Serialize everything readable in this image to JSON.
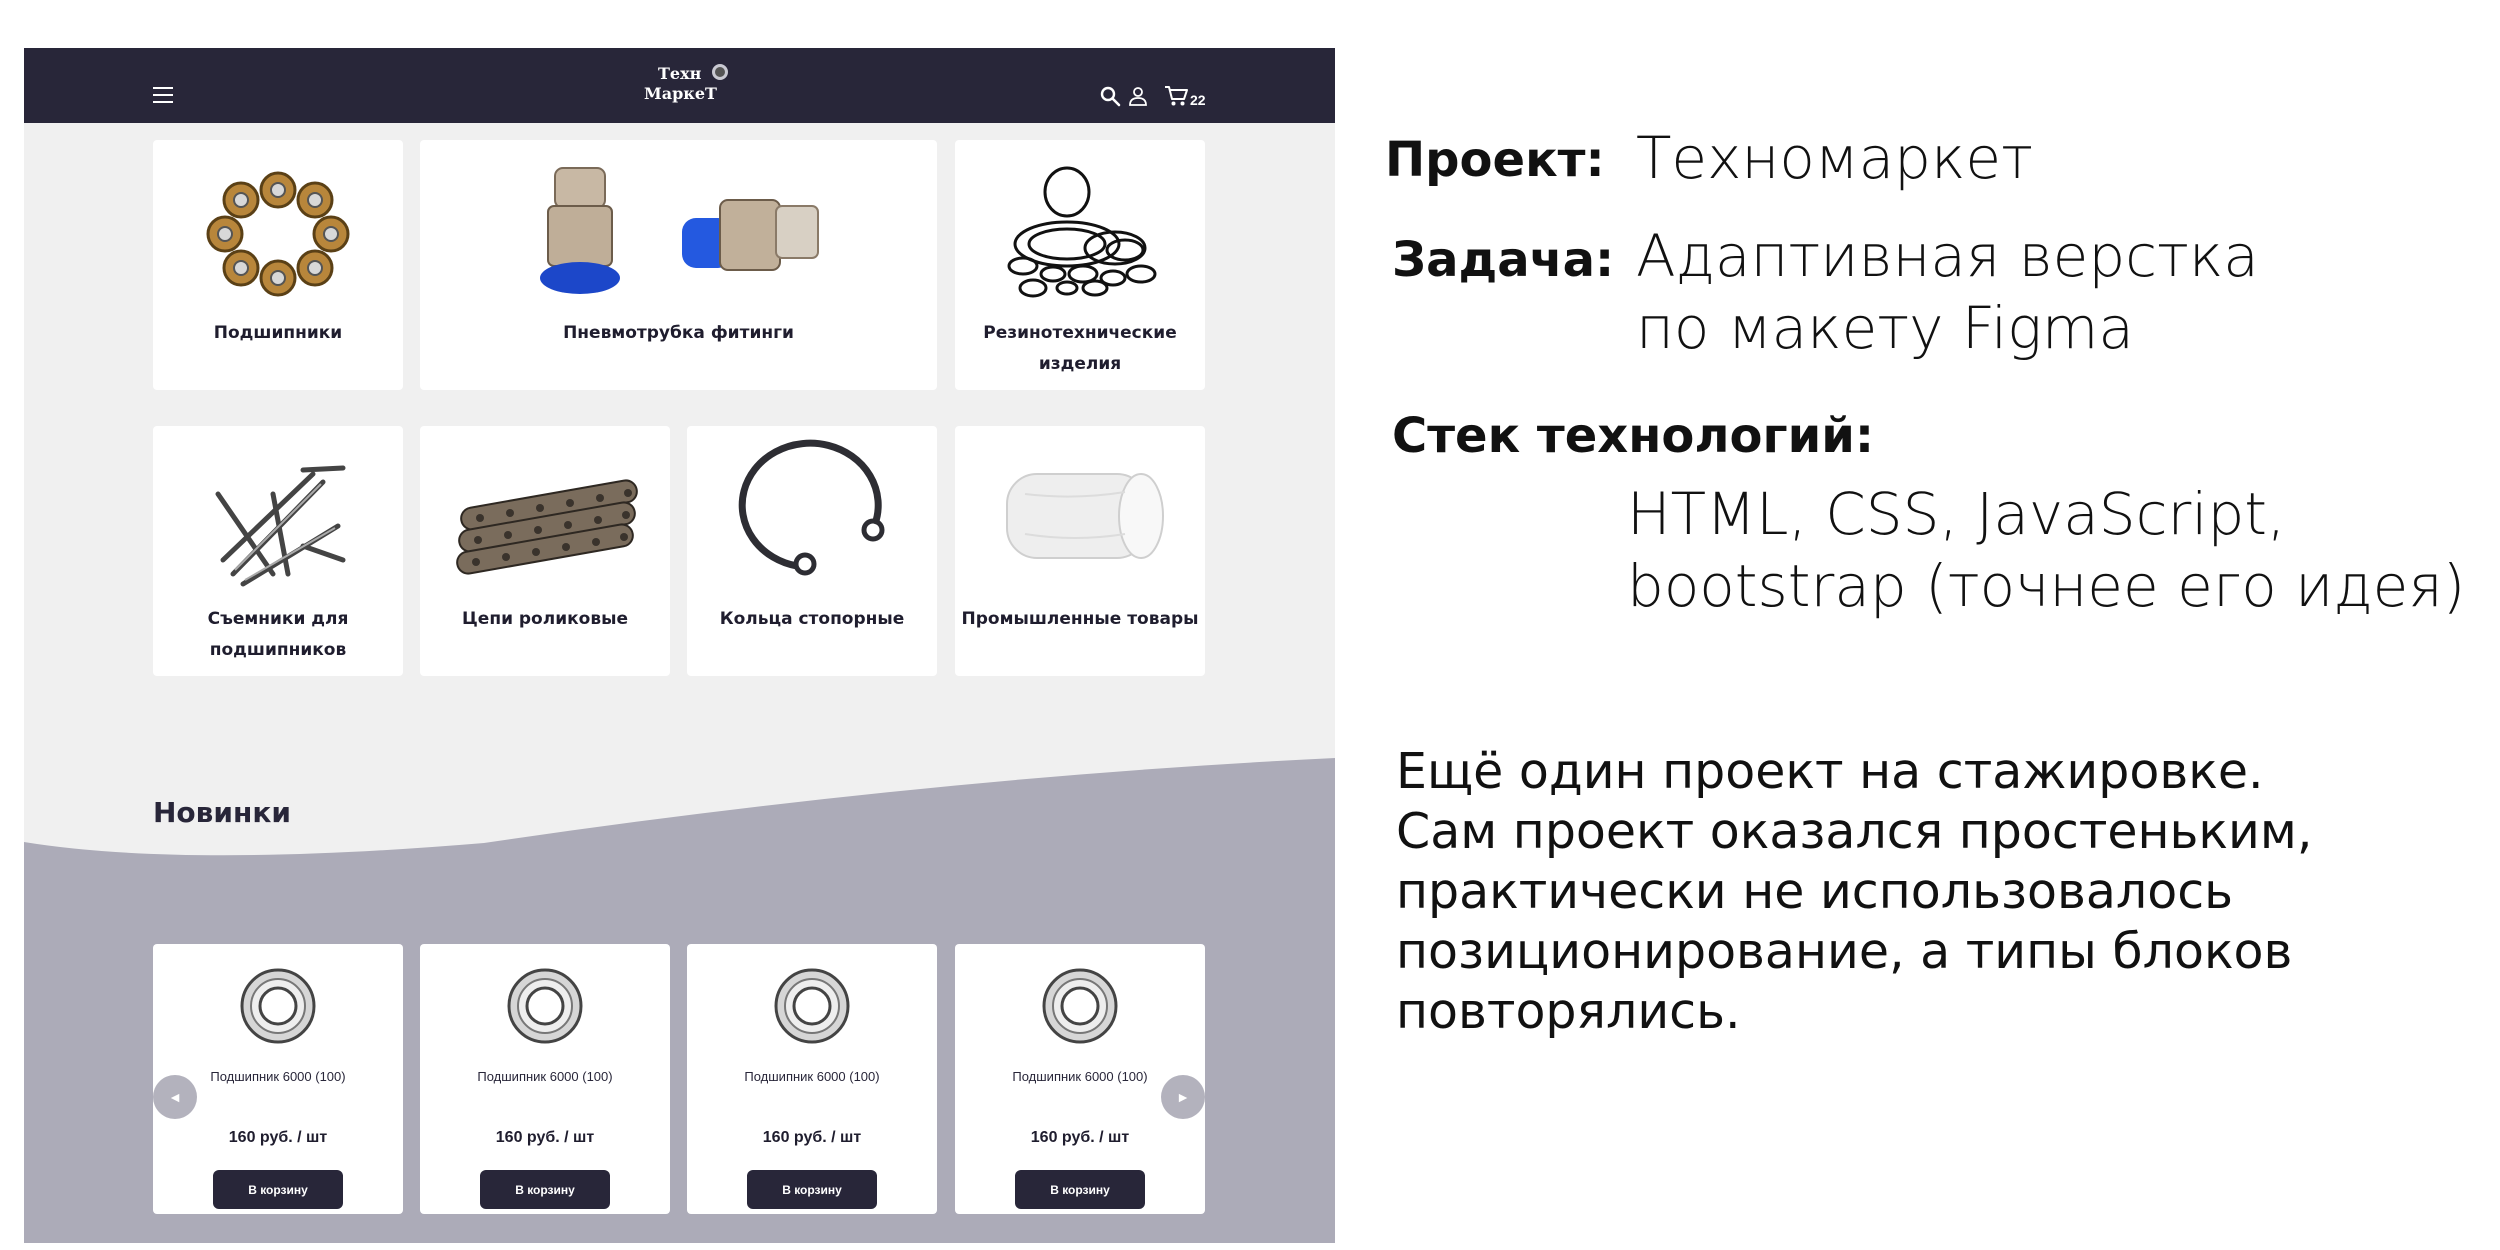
{
  "header": {
    "logo_line1": "Техн",
    "logo_line2": "МаркеТ",
    "cart_count": "22",
    "icons": [
      "menu-icon",
      "search-icon",
      "user-icon",
      "cart-icon"
    ]
  },
  "categories": [
    {
      "label": "Подшипники",
      "icon": "bearings-image"
    },
    {
      "label": "Пневмотрубка фитинги",
      "icon": "fittings-image"
    },
    {
      "label_line1": "Резинотехнические",
      "label_line2": "изделия",
      "icon": "o-rings-image"
    },
    {
      "label_line1": "Съемники для",
      "label_line2": "подшипников",
      "icon": "pullers-image"
    },
    {
      "label": "Цепи роликовые",
      "icon": "roller-chain-image"
    },
    {
      "label": "Кольца стопорные",
      "icon": "retaining-ring-image"
    },
    {
      "label": "Промышленные товары",
      "icon": "fabric-roll-image"
    }
  ],
  "new_section": {
    "title": "Новинки",
    "products": [
      {
        "name": "Подшипник 6000 (100)",
        "price": "160 руб. / шт",
        "button": "В корзину"
      },
      {
        "name": "Подшипник 6000 (100)",
        "price": "160 руб. / шт",
        "button": "В корзину"
      },
      {
        "name": "Подшипник 6000 (100)",
        "price": "160 руб. / шт",
        "button": "В корзину"
      },
      {
        "name": "Подшипник 6000 (100)",
        "price": "160 руб. / шт",
        "button": "В корзину"
      }
    ],
    "prev_arrow": "◄",
    "next_arrow": "►"
  },
  "description": {
    "project_label": "Проект:",
    "project_value": "Техномаркет",
    "task_label": "Задача:",
    "task_line1": "Адаптивная верстка",
    "task_line2": "по макету Figma",
    "stack_label": "Стек технологий:",
    "stack_line1": "HTML, CSS,  JavaScript,",
    "stack_line2": "bootstrap (точнее его идея)",
    "para": [
      "Ещё один проект на стажировке.",
      "Сам проект оказался простеньким,",
      "практически не использовалось",
      "позиционирование, а типы блоков",
      "повторялись."
    ]
  },
  "colors": {
    "header_bg": "#282639",
    "page_bg": "#f0f0f0",
    "wave_bg": "#acabb8",
    "button_bg": "#282639",
    "card_bg": "#ffffff"
  }
}
